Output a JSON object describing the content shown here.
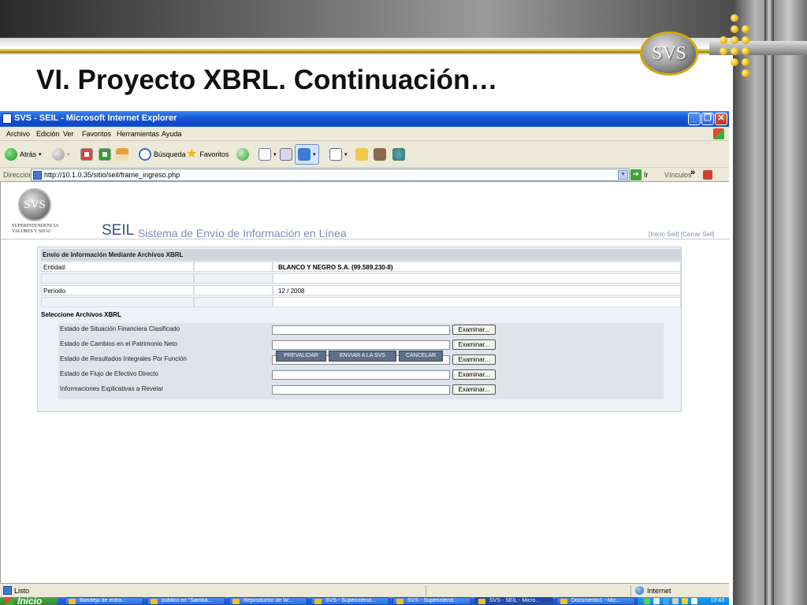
{
  "slide": {
    "title": "VI. Proyecto XBRL. Continuación…",
    "logo_text": "SVS"
  },
  "window": {
    "title": "SVS - SEIL - Microsoft Internet Explorer",
    "controls": [
      "_",
      "❐",
      "✕"
    ]
  },
  "menu": [
    "Archivo",
    "Edición",
    "Ver",
    "Favoritos",
    "Herramientas",
    "Ayuda"
  ],
  "toolbar": {
    "back_label": "Atrás",
    "search_label": "Búsqueda",
    "favorites_label": "Favoritos"
  },
  "address": {
    "label": "Dirección",
    "url": "http://10.1.0.35/sitio/seil/frame_ingreso.php",
    "go_label": "Ir",
    "links_label": "Vínculos",
    "more": "»"
  },
  "page": {
    "logo_text": "SVS",
    "org_name": "SUPERINTENDENCIA VALORES Y SEGU",
    "brand": "SEIL",
    "subtitle": "Sistema de Envío de Información en Línea",
    "links": "[Inicio Seil]   [Cerrar Seil]"
  },
  "form": {
    "header": "Envío de Información Mediante Archivos XBRL",
    "entity_label": "Entidad:",
    "entity_value": "BLANCO Y NEGRO S.A. (99.589.230-8)",
    "period_label": "Período",
    "period_value": "12 / 2008",
    "select_header": "Seleccione Archivos XBRL",
    "files": [
      {
        "label": "Estado de Situación Financiera Clasificado",
        "button": "Examinar..."
      },
      {
        "label": "Estado de Cambios en el Patrimonio Neto",
        "button": "Examinar..."
      },
      {
        "label": "Estado de Resultados Integrales Por Función",
        "button": "Examinar..."
      },
      {
        "label": "Estado de Flujo de Efectivo Directo",
        "button": "Examinar..."
      },
      {
        "label": "Informaciones Explicativas a Revelar",
        "button": "Examinar..."
      }
    ],
    "actions": [
      "PREVALIDAR",
      "ENVIAR A LA SVS",
      "CANCELAR"
    ]
  },
  "status": {
    "text": "Listo",
    "zone": "Internet"
  },
  "taskbar": {
    "start": "Inicio",
    "tasks": [
      "Bandeja de entra...",
      "publico en \"Samba...",
      "Reproductor de W...",
      "SVS - Superintend...",
      "SVS - Superintend...",
      "SVS - SEIL - Micro...",
      "Documento1 - Mic..."
    ],
    "clock": "13:43"
  }
}
